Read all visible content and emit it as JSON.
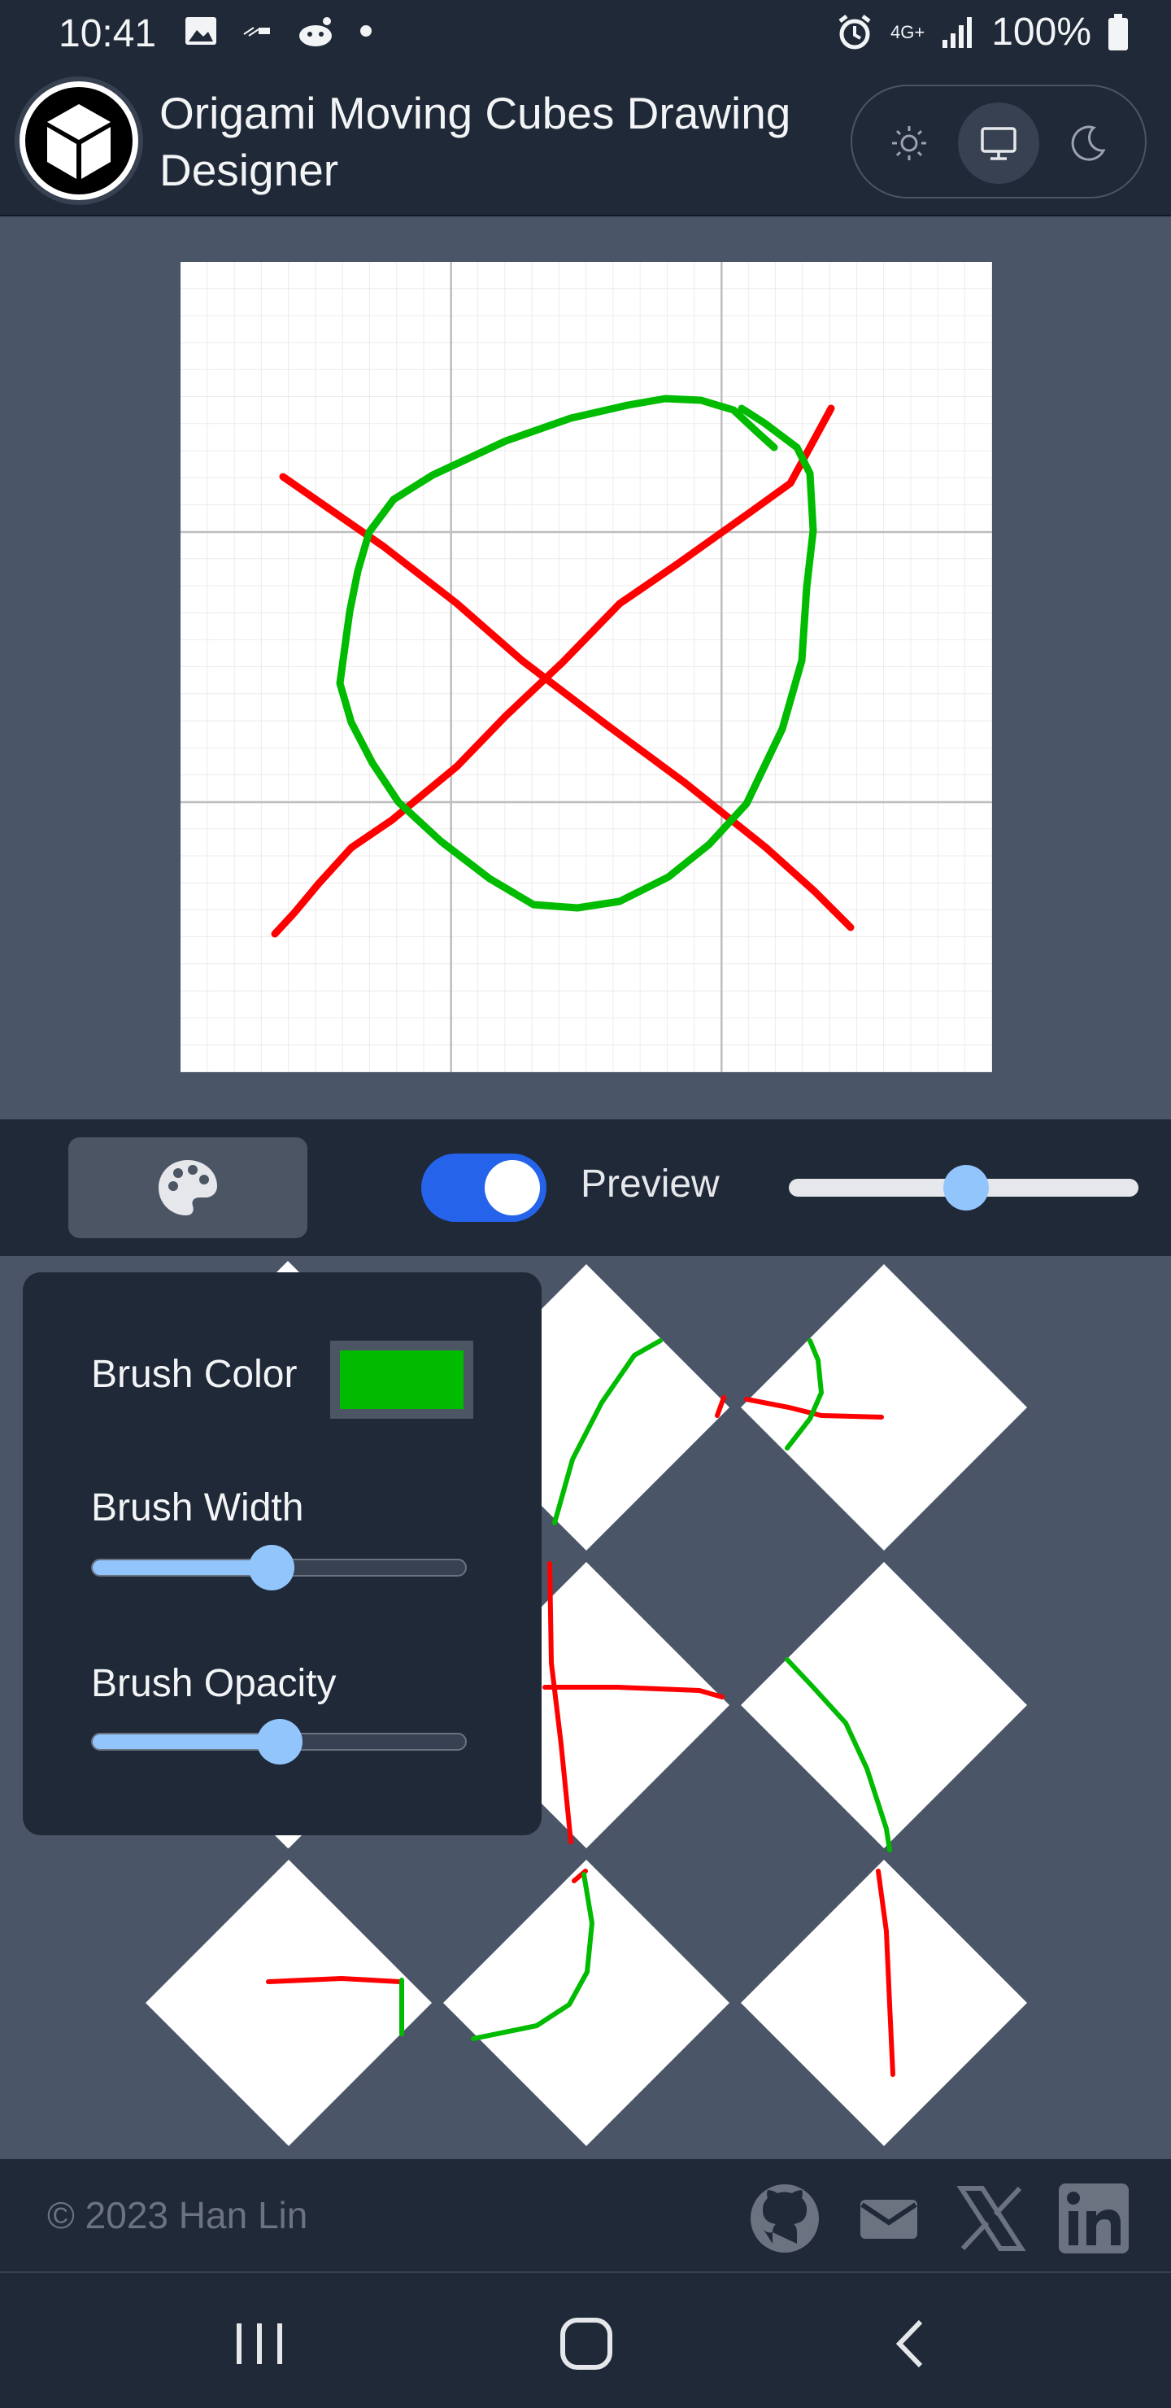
{
  "status": {
    "time": "10:41",
    "network": "4G+",
    "battery": "100%",
    "left_icons": [
      "image-icon",
      "ex-icon",
      "reddit-icon",
      "dot-icon"
    ],
    "right_icons": [
      "alarm-icon",
      "network-icon",
      "signal-icon",
      "battery-icon"
    ]
  },
  "header": {
    "title": "Origami Moving Cubes Drawing Designer",
    "logo_icon": "cube-icon",
    "theme_options": [
      {
        "name": "light",
        "icon": "sun-icon",
        "active": false
      },
      {
        "name": "system",
        "icon": "monitor-icon",
        "active": true
      },
      {
        "name": "dark",
        "icon": "moon-icon",
        "active": false
      }
    ]
  },
  "toolbar": {
    "palette_icon": "palette-icon",
    "preview_label": "Preview",
    "preview_enabled": true,
    "preview_slider_value": 0.5
  },
  "brush_panel": {
    "color_label": "Brush Color",
    "color_value": "#00bb00",
    "width_label": "Brush Width",
    "width_value": 0.5,
    "opacity_label": "Brush Opacity",
    "opacity_value": 0.5
  },
  "drawing": {
    "stroke_colors": [
      "#ff0000",
      "#00bb00"
    ]
  },
  "footer": {
    "copyright": "© 2023  Han Lin",
    "social_icons": [
      "github-icon",
      "mail-icon",
      "x-icon",
      "linkedin-icon"
    ]
  },
  "navigation": {
    "buttons": [
      "recent-apps",
      "home",
      "back"
    ]
  }
}
